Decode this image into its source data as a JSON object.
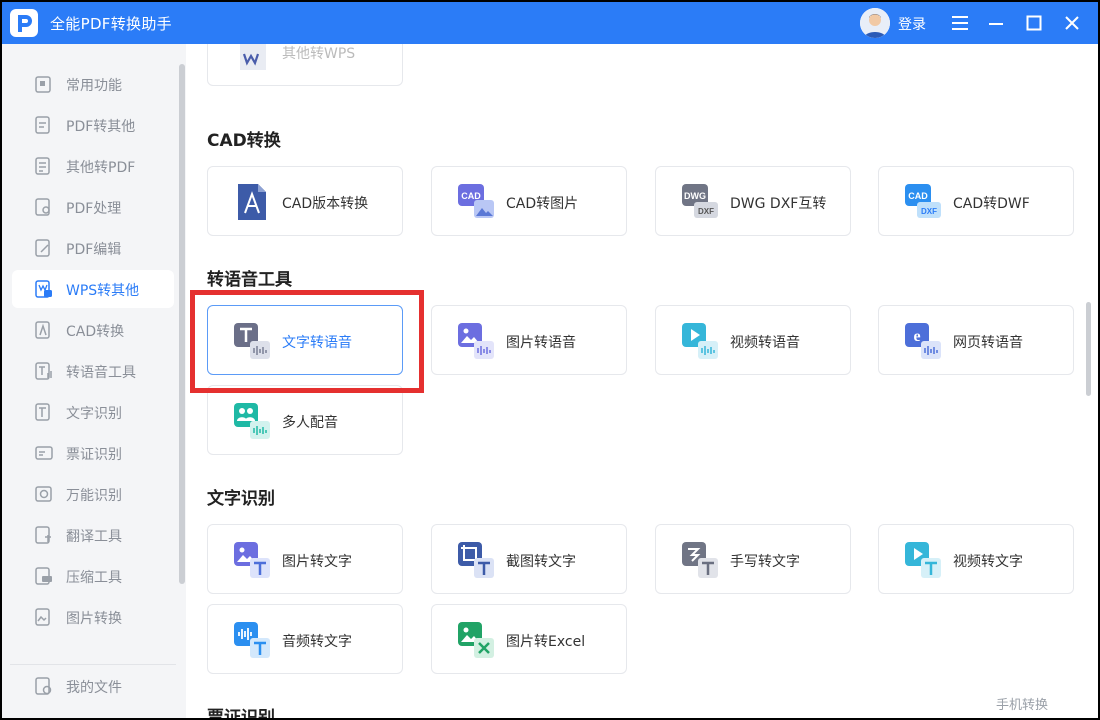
{
  "app": {
    "title": "全能PDF转换助手",
    "login_label": "登录"
  },
  "sidebar": {
    "items": [
      {
        "label": "常用功能",
        "icon": "common-functions-icon"
      },
      {
        "label": "PDF转其他",
        "icon": "pdf-to-other-icon"
      },
      {
        "label": "其他转PDF",
        "icon": "other-to-pdf-icon"
      },
      {
        "label": "PDF处理",
        "icon": "pdf-process-icon"
      },
      {
        "label": "PDF编辑",
        "icon": "pdf-edit-icon"
      },
      {
        "label": "WPS转其他",
        "icon": "wps-to-other-icon",
        "active": true
      },
      {
        "label": "CAD转换",
        "icon": "cad-convert-icon"
      },
      {
        "label": "转语音工具",
        "icon": "text-to-speech-icon"
      },
      {
        "label": "文字识别",
        "icon": "text-recognition-icon"
      },
      {
        "label": "票证识别",
        "icon": "ticket-recognition-icon"
      },
      {
        "label": "万能识别",
        "icon": "universal-recognition-icon"
      },
      {
        "label": "翻译工具",
        "icon": "translate-icon"
      },
      {
        "label": "压缩工具",
        "icon": "compress-icon"
      },
      {
        "label": "图片转换",
        "icon": "image-convert-icon"
      }
    ],
    "my_files": {
      "label": "我的文件",
      "icon": "my-files-icon"
    }
  },
  "main": {
    "partial_top_card": {
      "label": "其他转WPS"
    },
    "sections": [
      {
        "title": "CAD转换",
        "cards": [
          {
            "label": "CAD版本转换",
            "icon": "cad-version-icon"
          },
          {
            "label": "CAD转图片",
            "icon": "cad-to-image-icon",
            "badge": "CAD"
          },
          {
            "label": "DWG DXF互转",
            "icon": "dwg-dxf-icon",
            "badge": "DWG",
            "badge2": "DXF"
          },
          {
            "label": "CAD转DWF",
            "icon": "cad-to-dwf-icon",
            "badge": "CAD",
            "badge2": "DXF"
          }
        ]
      },
      {
        "title": "转语音工具",
        "cards": [
          {
            "label": "文字转语音",
            "icon": "text-to-voice-icon",
            "selected": true
          },
          {
            "label": "图片转语音",
            "icon": "image-to-voice-icon"
          },
          {
            "label": "视频转语音",
            "icon": "video-to-voice-icon"
          },
          {
            "label": "网页转语音",
            "icon": "webpage-to-voice-icon"
          },
          {
            "label": "多人配音",
            "icon": "multi-voice-icon"
          }
        ]
      },
      {
        "title": "文字识别",
        "cards": [
          {
            "label": "图片转文字",
            "icon": "image-to-text-icon"
          },
          {
            "label": "截图转文字",
            "icon": "screenshot-to-text-icon"
          },
          {
            "label": "手写转文字",
            "icon": "handwriting-to-text-icon"
          },
          {
            "label": "视频转文字",
            "icon": "video-to-text-icon"
          },
          {
            "label": "音频转文字",
            "icon": "audio-to-text-icon"
          },
          {
            "label": "图片转Excel",
            "icon": "image-to-excel-icon"
          }
        ]
      },
      {
        "title": "票证识别"
      }
    ],
    "mobile_label": "手机转换"
  },
  "colors": {
    "accent": "#2b7cf7",
    "highlight": "#e5302f"
  }
}
